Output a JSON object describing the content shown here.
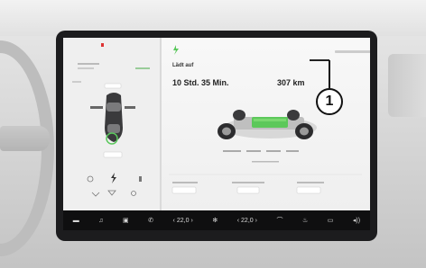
{
  "charging": {
    "title": "Lädt auf",
    "time_remaining": "10 Std. 35 Min.",
    "range": "307 km"
  },
  "callout": {
    "label": "1"
  },
  "taskbar": {
    "temp_left": "22,0",
    "temp_right": "22,0"
  },
  "colors": {
    "battery_fill": "#5cc85a",
    "charge_bolt": "#5ac85c",
    "bezel": "#1c1c1e",
    "taskbar": "#0f0f10"
  },
  "icons": [
    "car-top-view-icon",
    "charging-bolt-icon",
    "battery-pack-icon",
    "music-icon",
    "phone-icon",
    "fan-icon",
    "volume-icon",
    "seat-heater-icon",
    "wiper-icon",
    "defrost-icon",
    "menu-icon"
  ]
}
